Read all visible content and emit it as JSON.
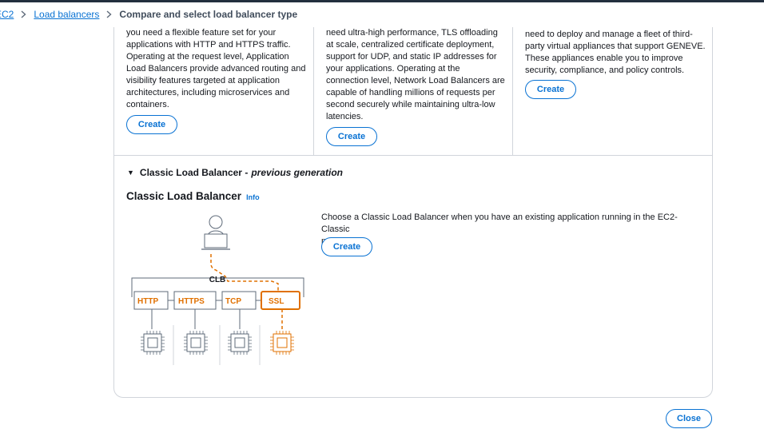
{
  "breadcrumb": {
    "root": "EC2",
    "load_balancers": "Load balancers",
    "current": "Compare and select load balancer type"
  },
  "cards": [
    {
      "description_lines": [
        "you need a flexible feature set for your",
        "applications with HTTP and HTTPS traffic.",
        "Operating at the request level, Application",
        "Load Balancers provide advanced routing and",
        "visibility features targeted at application",
        "architectures, including microservices and",
        "containers."
      ],
      "create_label": "Create"
    },
    {
      "description_lines": [
        "need ultra-high performance, TLS offloading",
        "at scale, centralized certificate deployment,",
        "support for UDP, and static IP addresses for",
        "your applications. Operating at the",
        "connection level, Network Load Balancers are",
        "capable of handling millions of requests per",
        "second securely while maintaining ultra-low",
        "latencies."
      ],
      "create_label": "Create"
    },
    {
      "description_lines": [
        "need to deploy and manage a fleet of third-",
        "party virtual appliances that support GENEVE.",
        "These appliances enable you to improve",
        "security, compliance, and policy controls."
      ],
      "create_label": "Create"
    }
  ],
  "classic": {
    "expander_label": "Classic Load Balancer -",
    "expander_emphasis": "previous generation",
    "title": "Classic Load Balancer",
    "info_label": "Info",
    "description_lines": [
      "Choose a Classic Load Balancer when you have an existing application running in the EC2-Classic",
      "network."
    ],
    "create_label": "Create"
  },
  "diagram": {
    "clb_label": "CLB",
    "protocols": [
      "HTTP",
      "HTTPS",
      "TCP",
      "SSL"
    ],
    "highlight_protocol": "SSL",
    "colors": {
      "accent": "#e07000",
      "neutral": "#5f6b7a"
    }
  },
  "footer": {
    "close_label": "Close"
  },
  "colors": {
    "link": "#0972d3",
    "border": "#d1d5db",
    "text": "#16191f"
  }
}
